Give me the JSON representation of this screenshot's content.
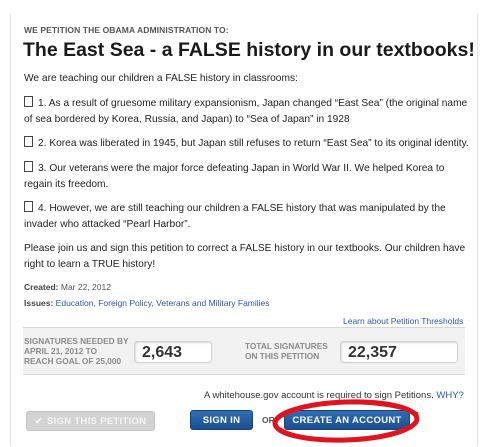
{
  "header": {
    "kicker": "WE PETITION THE OBAMA ADMINISTRATION TO:",
    "title": "The East Sea - a FALSE history in our textbooks!"
  },
  "body": {
    "intro": "We are teaching our children a FALSE history in classrooms:",
    "points": [
      "1. As a result of gruesome military expansionism, Japan changed “East Sea” (the original name of sea bordered by Korea, Russia, and Japan) to “Sea of Japan” in 1928",
      "2. Korea was liberated in 1945, but Japan still refuses to return “East Sea” to its original identity.",
      "3. Our veterans were the major force defeating Japan in World War II. We helped Korea to regain its freedom.",
      "4. However, we are still teaching our children a FALSE history that was manipulated by the invader who attacked “Pearl Harbor”."
    ],
    "closing": "Please join us and sign this petition to correct a FALSE history in our textbooks. Our children have right to learn a TRUE history!"
  },
  "meta": {
    "created_label": "Created:",
    "created_date": "Mar 22, 2012",
    "issues_label": "Issues:",
    "issues": "Education, Foreign Policy, Veterans and Military Families",
    "threshold_link": "Learn about Petition Thresholds"
  },
  "signatures": {
    "needed_label_1": "SIGNATURES NEEDED BY",
    "needed_label_2": "APRIL 21, 2012 TO",
    "needed_label_3": "REACH GOAL OF 25,000",
    "needed_value": "2,643",
    "total_label_1": "TOTAL SIGNATURES",
    "total_label_2": "ON THIS PETITION",
    "total_value": "22,357"
  },
  "actions": {
    "account_note": "A whitehouse.gov account is required to sign Petitions.",
    "why_link": "WHY?",
    "sign_petition": "SIGN THIS PETITION",
    "sign_in": "SIGN IN",
    "or": "OR",
    "create_account": "CREATE AN ACCOUNT"
  },
  "colors": {
    "link": "#2a5aa8",
    "primary_button": "#1b4f8f",
    "disabled_button": "#d3d3d3",
    "annotation": "#e0141e"
  },
  "icons": {
    "bullet": "box-glyph-icon",
    "sign_check": "checkmark-icon"
  }
}
